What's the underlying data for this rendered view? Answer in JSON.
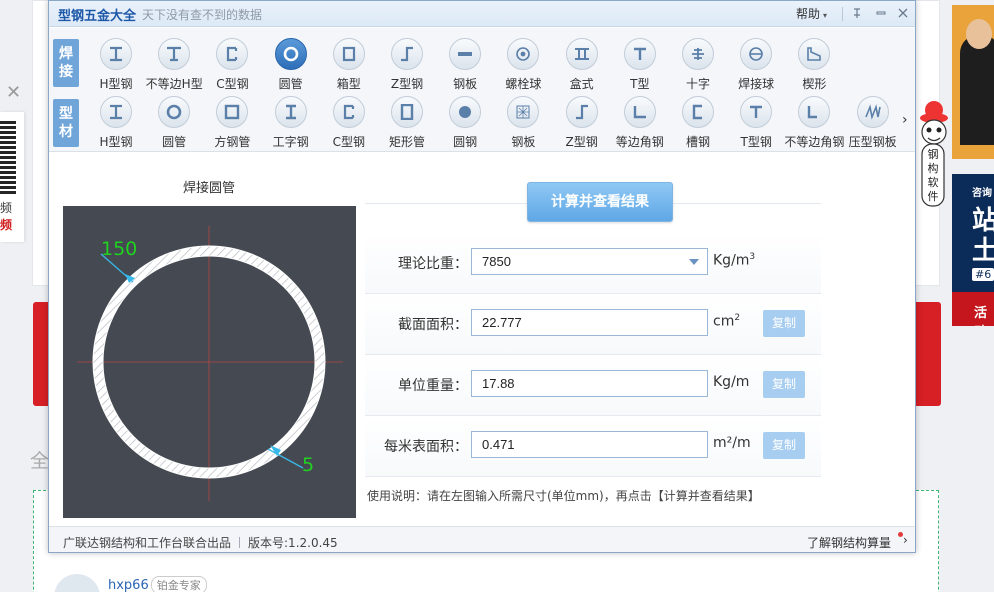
{
  "app": {
    "title": "型钢五金大全",
    "slogan": "天下没有查不到的数据",
    "help_label": "帮助",
    "help_arrow": "▾"
  },
  "rows": [
    {
      "label_chars": [
        "焊",
        "接"
      ],
      "items": [
        {
          "label": "H型钢",
          "icon": "h-beam-icon"
        },
        {
          "label": "不等边H型",
          "icon": "unequal-h-beam-icon"
        },
        {
          "label": "C型钢",
          "icon": "c-channel-icon"
        },
        {
          "label": "圆管",
          "icon": "round-pipe-icon",
          "selected": true
        },
        {
          "label": "箱型",
          "icon": "box-section-icon"
        },
        {
          "label": "Z型钢",
          "icon": "z-section-icon"
        },
        {
          "label": "钢板",
          "icon": "steel-plate-icon"
        },
        {
          "label": "螺栓球",
          "icon": "bolt-ball-icon"
        },
        {
          "label": "盒式",
          "icon": "box-type-icon"
        },
        {
          "label": "T型",
          "icon": "t-section-icon"
        },
        {
          "label": "十字",
          "icon": "cross-section-icon"
        },
        {
          "label": "焊接球",
          "icon": "welded-ball-icon"
        },
        {
          "label": "楔形",
          "icon": "wedge-icon"
        }
      ]
    },
    {
      "label_chars": [
        "型",
        "材"
      ],
      "items": [
        {
          "label": "H型钢",
          "icon": "h-beam-icon"
        },
        {
          "label": "圆管",
          "icon": "round-pipe-icon"
        },
        {
          "label": "方钢管",
          "icon": "square-tube-icon"
        },
        {
          "label": "工字钢",
          "icon": "i-beam-icon"
        },
        {
          "label": "C型钢",
          "icon": "c-channel-icon"
        },
        {
          "label": "矩形管",
          "icon": "rect-tube-icon"
        },
        {
          "label": "圆钢",
          "icon": "round-bar-icon"
        },
        {
          "label": "钢板",
          "icon": "checkered-plate-icon"
        },
        {
          "label": "Z型钢",
          "icon": "z-section-icon"
        },
        {
          "label": "等边角钢",
          "icon": "equal-angle-icon"
        },
        {
          "label": "槽钢",
          "icon": "channel-icon"
        },
        {
          "label": "T型钢",
          "icon": "t-section-icon"
        },
        {
          "label": "不等边角钢",
          "icon": "unequal-angle-icon"
        },
        {
          "label": "压型钢板",
          "icon": "profiled-sheet-icon"
        }
      ]
    }
  ],
  "figure": {
    "title": "焊接圆管",
    "diameter_label": "150",
    "thickness_label": "5"
  },
  "calc_button": "计算并查看结果",
  "form": [
    {
      "label": "理论比重：",
      "value": "7850",
      "unit": "Kg/m",
      "unit_sup": "3",
      "has_select": true
    },
    {
      "label": "截面面积：",
      "value": "22.777",
      "unit": "cm",
      "unit_sup": "2",
      "copy": "复制"
    },
    {
      "label": "单位重量：",
      "value": "17.88",
      "unit": "Kg/m",
      "unit_sup": "",
      "copy": "复制"
    },
    {
      "label": "每米表面积：",
      "value": "0.471",
      "unit": "m²/m",
      "unit_sup": "",
      "copy": "复制"
    }
  ],
  "usage": "使用说明：请在左图输入所需尺寸(单位mm)，再点击【计算并查看结果】",
  "status": {
    "producer": "广联达钢结构和工作台联合出品",
    "version": "版本号:1.2.0.45",
    "learn_more": "了解钢结构算量"
  },
  "background": {
    "quan": "全",
    "username": "hxp66",
    "user_badge": "铂金专家",
    "left_text1": "频",
    "left_text2": "频",
    "ad2_t1": "咨询",
    "ad2_t2a": "站",
    "ad2_t2b": "土",
    "ad2_t3": "#6",
    "ad2_t4": "活动"
  },
  "mascot_text": [
    "钢",
    "构",
    "软",
    "件"
  ],
  "colors": {
    "accent": "#2d6eb8",
    "row_label": "#6fa5d8",
    "dimension_text": "#1fd21f",
    "figure_bg": "#454a52"
  }
}
